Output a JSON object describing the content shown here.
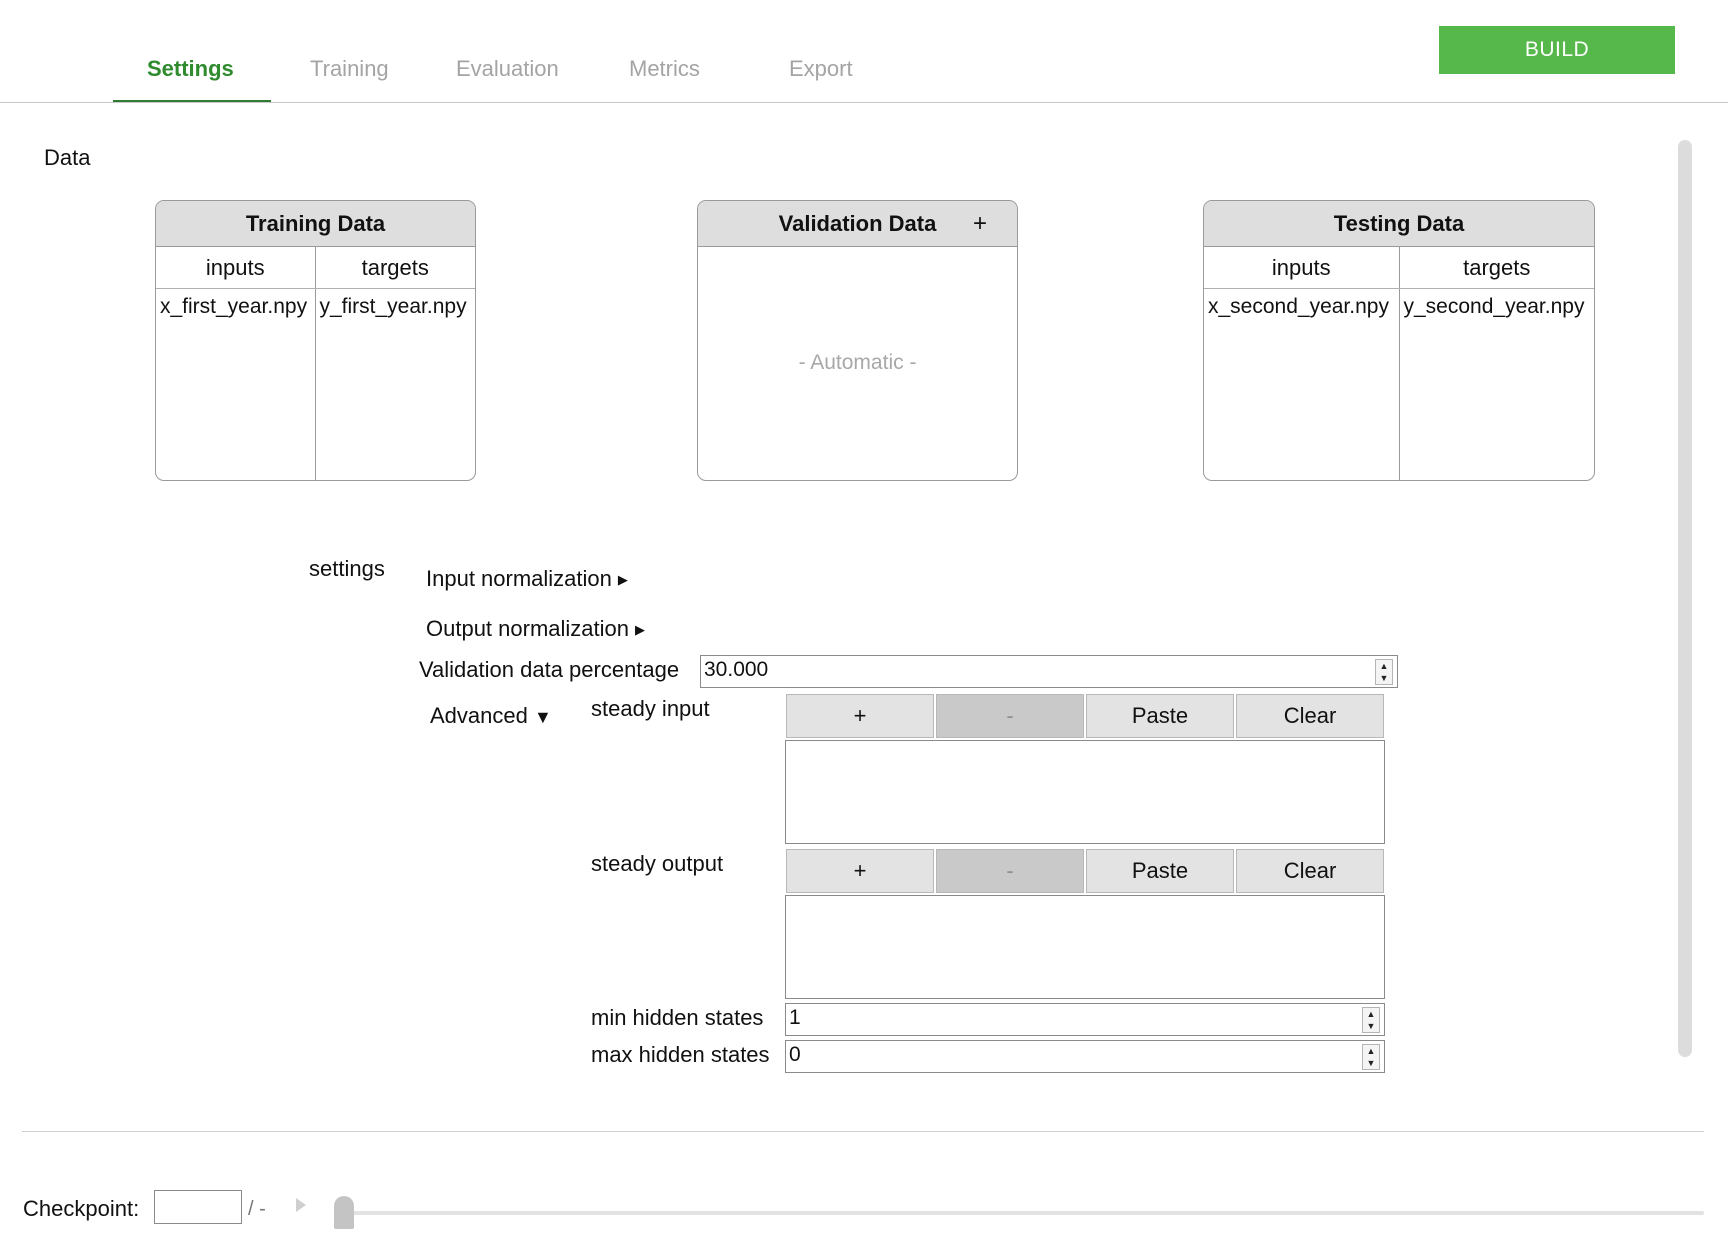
{
  "tabs": [
    {
      "label": "Settings",
      "active": true
    },
    {
      "label": "Training",
      "active": false
    },
    {
      "label": "Evaluation",
      "active": false
    },
    {
      "label": "Metrics",
      "active": false
    },
    {
      "label": "Export",
      "active": false
    }
  ],
  "build_label": "BUILD",
  "data_section_label": "Data",
  "training_data": {
    "title": "Training Data",
    "columns": [
      "inputs",
      "targets"
    ],
    "rows": [
      [
        "x_first_year.npy",
        "y_first_year.npy"
      ]
    ]
  },
  "validation_data": {
    "title": "Validation Data",
    "add_label": "+",
    "placeholder": "- Automatic -"
  },
  "testing_data": {
    "title": "Testing Data",
    "columns": [
      "inputs",
      "targets"
    ],
    "rows": [
      [
        "x_second_year.npy",
        "y_second_year.npy"
      ]
    ]
  },
  "settings": {
    "label": "settings",
    "input_normalization": "Input normalization",
    "output_normalization": "Output normalization",
    "expand_arrow": "▶",
    "validation_percentage_label": "Validation data percentage",
    "validation_percentage_value": "30.000",
    "advanced_label": "Advanced",
    "advanced_arrow": "▼",
    "steady_input_label": "steady input",
    "steady_output_label": "steady output",
    "list_buttons": {
      "add": "+",
      "remove": "-",
      "paste": "Paste",
      "clear": "Clear"
    },
    "min_hidden_states_label": "min hidden states",
    "min_hidden_states_value": "1",
    "max_hidden_states_label": "max hidden states",
    "max_hidden_states_value": "0"
  },
  "footer": {
    "checkpoint_label": "Checkpoint:",
    "checkpoint_value": "",
    "checkpoint_total": "/ -"
  },
  "colors": {
    "accent_green": "#56b84a",
    "active_tab": "#2e8b2e",
    "panel_header": "#dedede"
  }
}
